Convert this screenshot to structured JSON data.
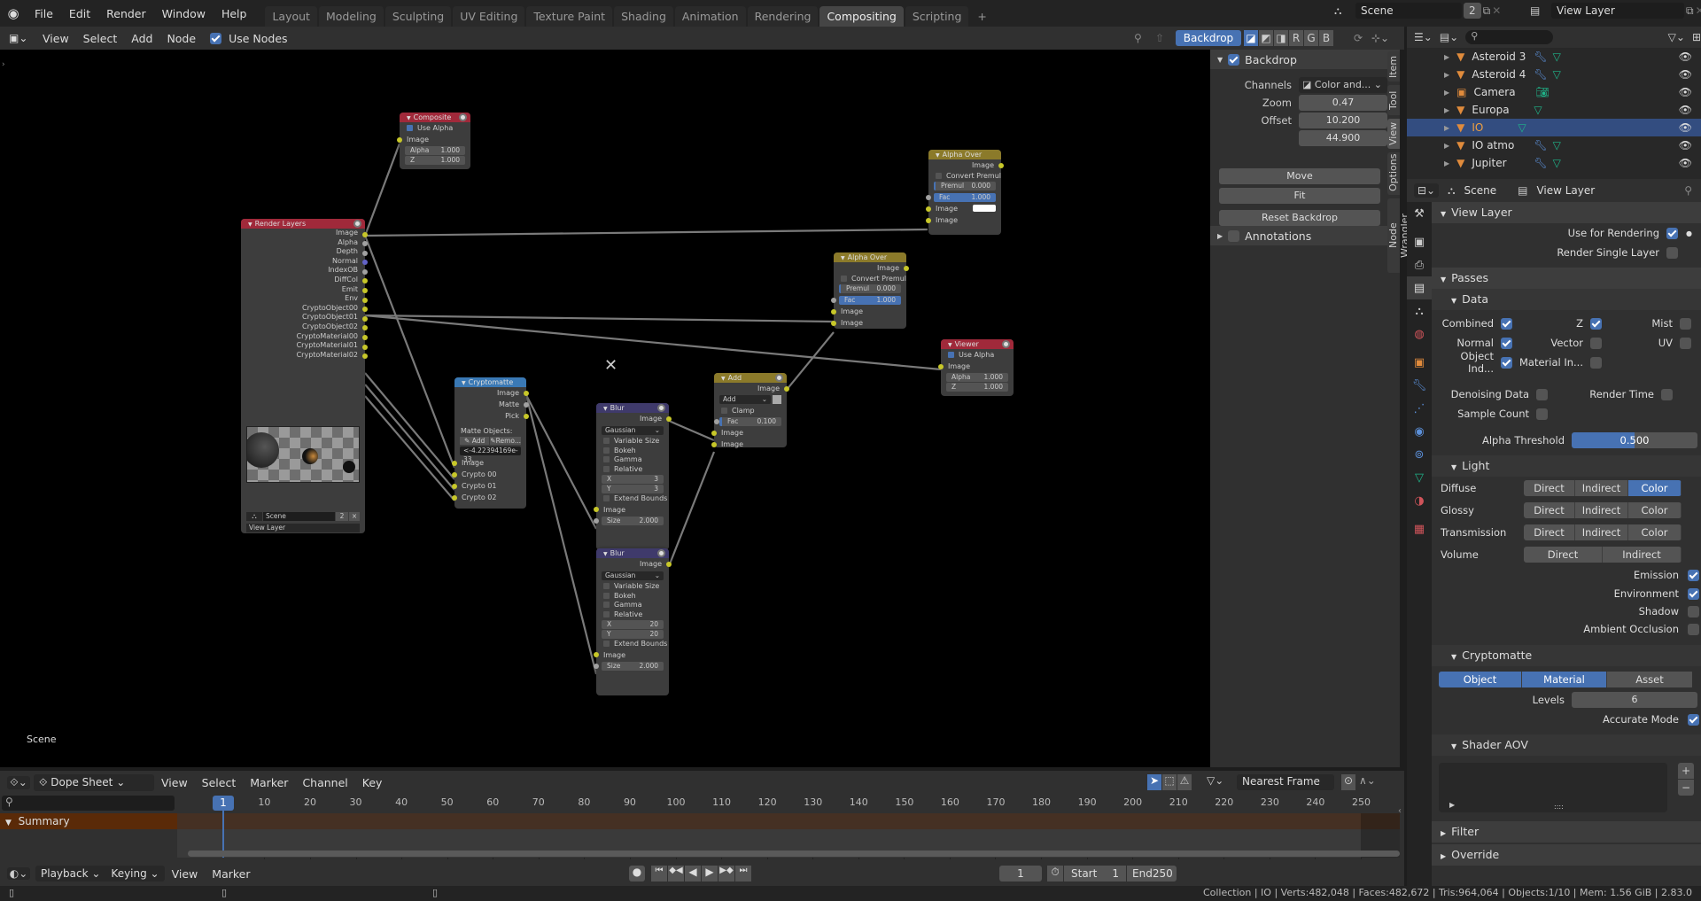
{
  "topbar": {
    "menus": [
      "File",
      "Edit",
      "Render",
      "Window",
      "Help"
    ],
    "workspaces": [
      "Layout",
      "Modeling",
      "Sculpting",
      "UV Editing",
      "Texture Paint",
      "Shading",
      "Animation",
      "Rendering",
      "Compositing",
      "Scripting"
    ],
    "active_workspace": "Compositing",
    "add_tab": "+",
    "scene_name": "Scene",
    "scene_users": "2",
    "view_layer": "View Layer"
  },
  "node_header": {
    "menus": [
      "View",
      "Select",
      "Add",
      "Node"
    ],
    "use_nodes_label": "Use Nodes",
    "use_nodes": true,
    "backdrop_label": "Backdrop",
    "channel_buttons": [
      "R",
      "G",
      "B"
    ]
  },
  "nodes": {
    "composite": {
      "title": "Composite",
      "use_alpha_label": "Use Alpha",
      "image": "Image",
      "alpha_label": "Alpha",
      "alpha": "1.000",
      "z_label": "Z",
      "z": "1.000"
    },
    "render_layers": {
      "title": "Render Layers",
      "outputs": [
        "Image",
        "Alpha",
        "Depth",
        "Normal",
        "IndexOB",
        "DiffCol",
        "Emit",
        "Env",
        "CryptoObject00",
        "CryptoObject01",
        "CryptoObject02",
        "CryptoMaterial00",
        "CryptoMaterial01",
        "CryptoMaterial02"
      ],
      "scene": "Scene",
      "scene_users": "2",
      "layer": "View Layer"
    },
    "cryptomatte": {
      "title": "Cryptomatte",
      "outputs": [
        "Image",
        "Matte",
        "Pick"
      ],
      "matte_objects_label": "Matte Objects:",
      "add_label": "Add",
      "remove_label": "Remo...",
      "matte_value": "<-4.22394169e-33...",
      "inputs": [
        "Image",
        "Crypto 00",
        "Crypto 01",
        "Crypto 02"
      ]
    },
    "blur1": {
      "title": "Blur",
      "output": "Image",
      "filter": "Gaussian",
      "options": [
        "Variable Size",
        "Bokeh",
        "Gamma",
        "Relative"
      ],
      "x": "3",
      "y": "3",
      "extend": "Extend Bounds",
      "input": "Image",
      "size_label": "Size",
      "size": "2.000"
    },
    "blur2": {
      "title": "Blur",
      "output": "Image",
      "filter": "Gaussian",
      "options": [
        "Variable Size",
        "Bokeh",
        "Gamma",
        "Relative"
      ],
      "x": "20",
      "y": "20",
      "extend": "Extend Bounds",
      "input": "Image",
      "size_label": "Size",
      "size": "2.000"
    },
    "add": {
      "title": "Add",
      "output": "Image",
      "blend": "Add",
      "clamp": "Clamp",
      "fac_label": "Fac",
      "fac": "0.100",
      "inputs": [
        "Image",
        "Image"
      ]
    },
    "alpha_over1": {
      "title": "Alpha Over",
      "output": "Image",
      "convert": "Convert Premul",
      "premul_label": "Premul",
      "premul": "0.000",
      "fac_label": "Fac",
      "fac": "1.000",
      "inputs": [
        "Image",
        "Image"
      ]
    },
    "alpha_over2": {
      "title": "Alpha Over",
      "output": "Image",
      "convert": "Convert Premul",
      "premul_label": "Premul",
      "premul": "0.000",
      "fac_label": "Fac",
      "fac": "1.000",
      "inputs": [
        "Image",
        "Image"
      ]
    },
    "viewer": {
      "title": "Viewer",
      "use_alpha_label": "Use Alpha",
      "image": "Image",
      "alpha_label": "Alpha",
      "alpha": "1.000",
      "z_label": "Z",
      "z": "1.000"
    }
  },
  "node_tree_name": "Scene",
  "npanel": {
    "backdrop_label": "Backdrop",
    "channels_label": "Channels",
    "channels_value": "Color and...",
    "zoom_label": "Zoom",
    "zoom": "0.47",
    "offset_label": "Offset",
    "offset_x": "10.200",
    "offset_y": "44.900",
    "move": "Move",
    "fit": "Fit",
    "reset": "Reset Backdrop",
    "annotations": "Annotations",
    "tabs": [
      "Item",
      "Tool",
      "View",
      "Options",
      "Node Wrangler"
    ]
  },
  "outliner": {
    "items": [
      {
        "name": "Asteroid 3",
        "selected": false
      },
      {
        "name": "Asteroid 4",
        "selected": false
      },
      {
        "name": "Camera",
        "selected": false
      },
      {
        "name": "Europa",
        "selected": false
      },
      {
        "name": "IO",
        "selected": true
      },
      {
        "name": "IO atmo",
        "selected": false
      },
      {
        "name": "Jupiter",
        "selected": false
      }
    ]
  },
  "properties": {
    "scene": "Scene",
    "view_layer": "View Layer",
    "view_layer_section": "View Layer",
    "use_for_rendering": "Use for Rendering",
    "render_single_layer": "Render Single Layer",
    "passes": "Passes",
    "data": "Data",
    "combined": "Combined",
    "z": "Z",
    "mist": "Mist",
    "normal": "Normal",
    "vector": "Vector",
    "uv": "UV",
    "object_index": "Object Ind...",
    "material_index": "Material In...",
    "denoising": "Denoising Data",
    "render_time": "Render Time",
    "sample_count": "Sample Count",
    "alpha_threshold_label": "Alpha Threshold",
    "alpha_threshold": "0.500",
    "light": "Light",
    "diffuse": "Diffuse",
    "glossy": "Glossy",
    "transmission": "Transmission",
    "volume": "Volume",
    "direct": "Direct",
    "indirect": "Indirect",
    "color": "Color",
    "emission": "Emission",
    "environment": "Environment",
    "shadow": "Shadow",
    "ao": "Ambient Occlusion",
    "cryptomatte": "Cryptomatte",
    "crypto_object": "Object",
    "crypto_material": "Material",
    "crypto_asset": "Asset",
    "levels_label": "Levels",
    "levels": "6",
    "accurate_mode": "Accurate Mode",
    "shader_aov": "Shader AOV",
    "filter": "Filter",
    "override": "Override"
  },
  "dopesheet": {
    "mode": "Dope Sheet",
    "menus": [
      "View",
      "Select",
      "Marker",
      "Channel",
      "Key"
    ],
    "snap": "Nearest Frame",
    "frames": [
      "10",
      "20",
      "30",
      "40",
      "50",
      "60",
      "70",
      "80",
      "90",
      "100",
      "110",
      "120",
      "130",
      "140",
      "150",
      "160",
      "170",
      "180",
      "190",
      "200",
      "210",
      "220",
      "230",
      "240",
      "250"
    ],
    "current_frame": "1",
    "summary": "Summary"
  },
  "playback": {
    "menus": [
      "Playback",
      "Keying"
    ],
    "extra": [
      "View",
      "Marker"
    ],
    "frame": "1",
    "start_label": "Start",
    "start": "1",
    "end_label": "End",
    "end": "250"
  },
  "status": "Collection | IO | Verts:482,048 | Faces:482,672 | Tris:964,064 | Objects:1/10 | Mem: 1.56 GiB | 2.83.0"
}
